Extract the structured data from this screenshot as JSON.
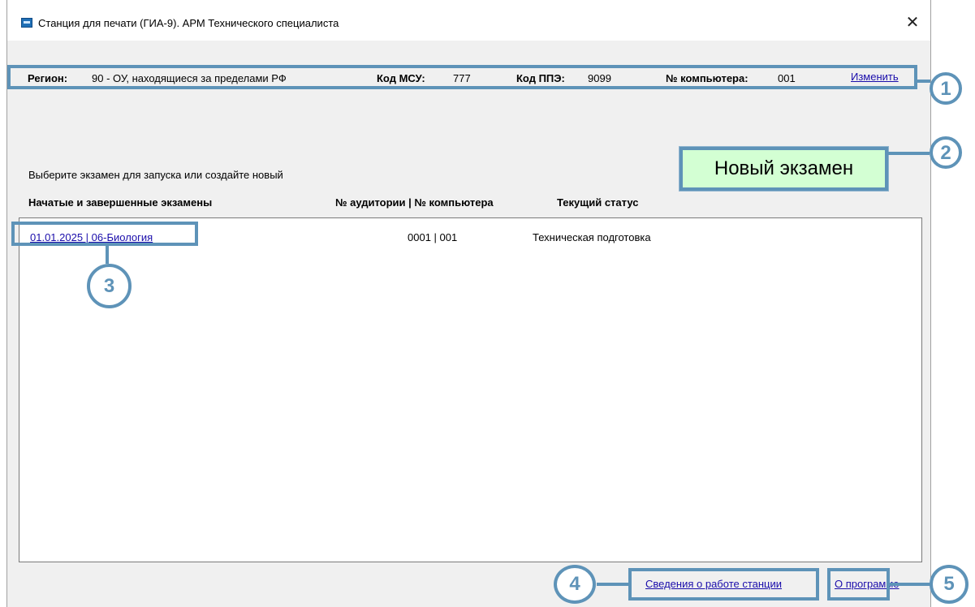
{
  "window": {
    "title": "Станция для печати (ГИА-9). АРМ Технического специалиста",
    "close_glyph": "✕"
  },
  "info": {
    "region_label": "Регион:",
    "region_value": "90 - ОУ, находящиеся за пределами РФ",
    "msu_label": "Код МСУ:",
    "msu_value": "777",
    "ppe_label": "Код ППЭ:",
    "ppe_value": "9099",
    "computer_label": "№ компьютера:",
    "computer_value": "001",
    "change_link": "Изменить"
  },
  "main": {
    "prompt": "Выберите экзамен для запуска или создайте новый",
    "new_exam_button": "Новый экзамен",
    "columns": {
      "exams": "Начатые и завершенные экзамены",
      "auditorium_computer": "№ аудитории | № компьютера",
      "status": "Текущий статус"
    },
    "exams": [
      {
        "name": "01.01.2025 | 06-Биология",
        "auditorium_computer": "0001 | 001",
        "status": "Техническая подготовка"
      }
    ]
  },
  "footer": {
    "station_info_link": "Сведения о работе станции",
    "about_link": "О программе"
  },
  "callouts": {
    "c1": "1",
    "c2": "2",
    "c3": "3",
    "c4": "4",
    "c5": "5"
  },
  "colors": {
    "accent": "#5e93b8",
    "new_exam_bg": "#d3ffd3",
    "link": "#1a0dab"
  }
}
